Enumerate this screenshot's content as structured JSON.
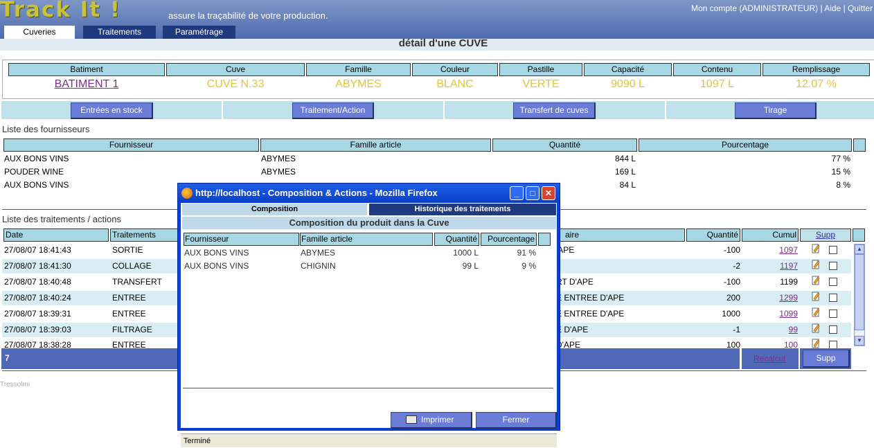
{
  "app": {
    "logo": "Track It !",
    "tagline": "assure la traçabilité de votre production.",
    "toplinks": "Mon compte (ADMINISTRATEUR) | Aide | Quitter",
    "tabs": [
      "Cuveries",
      "Traitements",
      "Paramétrage"
    ]
  },
  "page_title": "détail d'une CUVE",
  "cuve": {
    "headers": [
      "Batiment",
      "Cuve",
      "Famille",
      "Couleur",
      "Pastille",
      "Capacité",
      "Contenu",
      "Remplissage"
    ],
    "values": [
      "BATIMENT 1",
      "CUVE N.33",
      "ABYMES",
      "BLANC",
      "VERTE",
      "9090 L",
      "1097 L",
      "12.07 %"
    ]
  },
  "actions": [
    "Entrées en stock",
    "Traitement/Action",
    "Transfert de cuves",
    "Tirage"
  ],
  "fournisseurs": {
    "title": "Liste des fournisseurs",
    "headers": [
      "Fournisseur",
      "Famille article",
      "Quantité",
      "Pourcentage"
    ],
    "rows": [
      [
        "AUX BONS VINS",
        "ABYMES",
        "844 L",
        "77 %"
      ],
      [
        "POUDER WINE",
        "ABYMES",
        "169 L",
        "15 %"
      ],
      [
        "AUX BONS VINS",
        "",
        "84 L",
        "8 %"
      ]
    ]
  },
  "traitements": {
    "title": "Liste des traitements / actions",
    "headers": [
      "Date",
      "Traitements",
      "aire",
      "Quantité",
      "Cumul",
      "Supp"
    ],
    "rows": [
      [
        "27/08/07 18:41:43",
        "SORTIE",
        "'APE",
        "-100",
        "1097"
      ],
      [
        "27/08/07 18:41:30",
        "COLLAGE",
        "",
        "-2",
        "1197"
      ],
      [
        "27/08/07 18:40:48",
        "TRANSFERT",
        "RT D'APE",
        "-100",
        "1199"
      ],
      [
        "27/08/07 18:40:24",
        "ENTREE",
        "E ENTREE D'APE",
        "200",
        "1299"
      ],
      [
        "27/08/07 18:39:31",
        "ENTREE",
        "E ENTREE D'APE",
        "1000",
        "1099"
      ],
      [
        "27/08/07 18:39:03",
        "FILTRAGE",
        "E D'APE",
        "-1",
        "99"
      ],
      [
        "27/08/07 18:38:28",
        "ENTREE",
        "D'APE",
        "100",
        "100"
      ]
    ],
    "footer_count": "7",
    "recalcul": "Recalcul",
    "supp_button": "Supp"
  },
  "footer_credit": "Tressolmi",
  "popup": {
    "title": "http://localhost - Composition & Actions - Mozilla Firefox",
    "tabs": [
      "Composition",
      "Historique des traitements"
    ],
    "section_title": "Composition du produit dans la Cuve",
    "headers": [
      "Fournisseur",
      "Famille article",
      "Quantité",
      "Pourcentage"
    ],
    "rows": [
      [
        "AUX BONS VINS",
        "ABYMES",
        "1000 L",
        "91 %"
      ],
      [
        "AUX BONS VINS",
        "CHIGNIN",
        "99 L",
        "9 %"
      ]
    ],
    "print_button": "Imprimer",
    "close_button": "Fermer",
    "status": "Terminé"
  },
  "colors": {
    "header_blue": "#4e6cb0",
    "cell_header": "#a8d8e6",
    "value_yellow": "#e3c43a",
    "button_purple": "#6a7cd6",
    "popup_frame": "#0e3fd3"
  }
}
